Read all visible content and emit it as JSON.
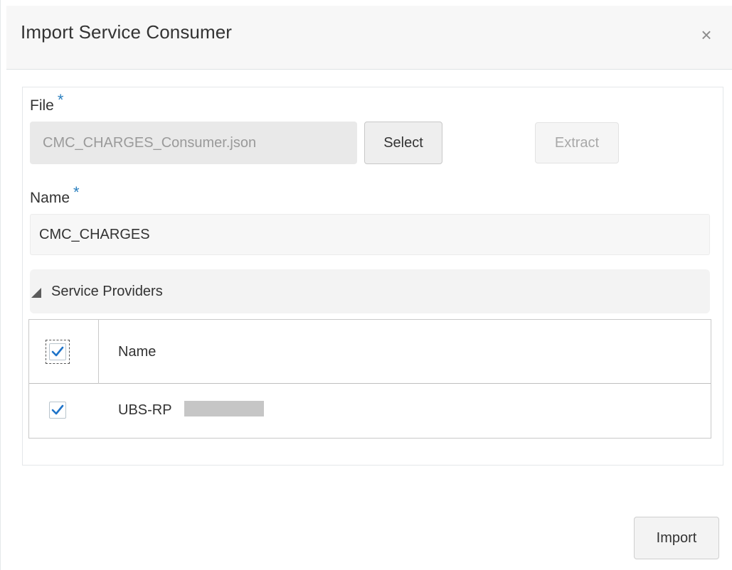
{
  "dialog": {
    "title": "Import Service Consumer",
    "close_icon": "close-icon",
    "close_glyph": "×"
  },
  "file": {
    "label": "File",
    "required_mark": "*",
    "value": "CMC_CHARGES_Consumer.json",
    "select_label": "Select",
    "extract_label": "Extract"
  },
  "name": {
    "label": "Name",
    "required_mark": "*",
    "value": "CMC_CHARGES"
  },
  "service_providers": {
    "title": "Service Providers",
    "expanded": true,
    "columns": [
      "Name"
    ],
    "select_all_checked": true,
    "rows": [
      {
        "name": "UBS-RP",
        "checked": true
      }
    ]
  },
  "footer": {
    "import_label": "Import"
  },
  "colors": {
    "accent": "#2a7fbf",
    "checkmark": "#1f74c9"
  }
}
